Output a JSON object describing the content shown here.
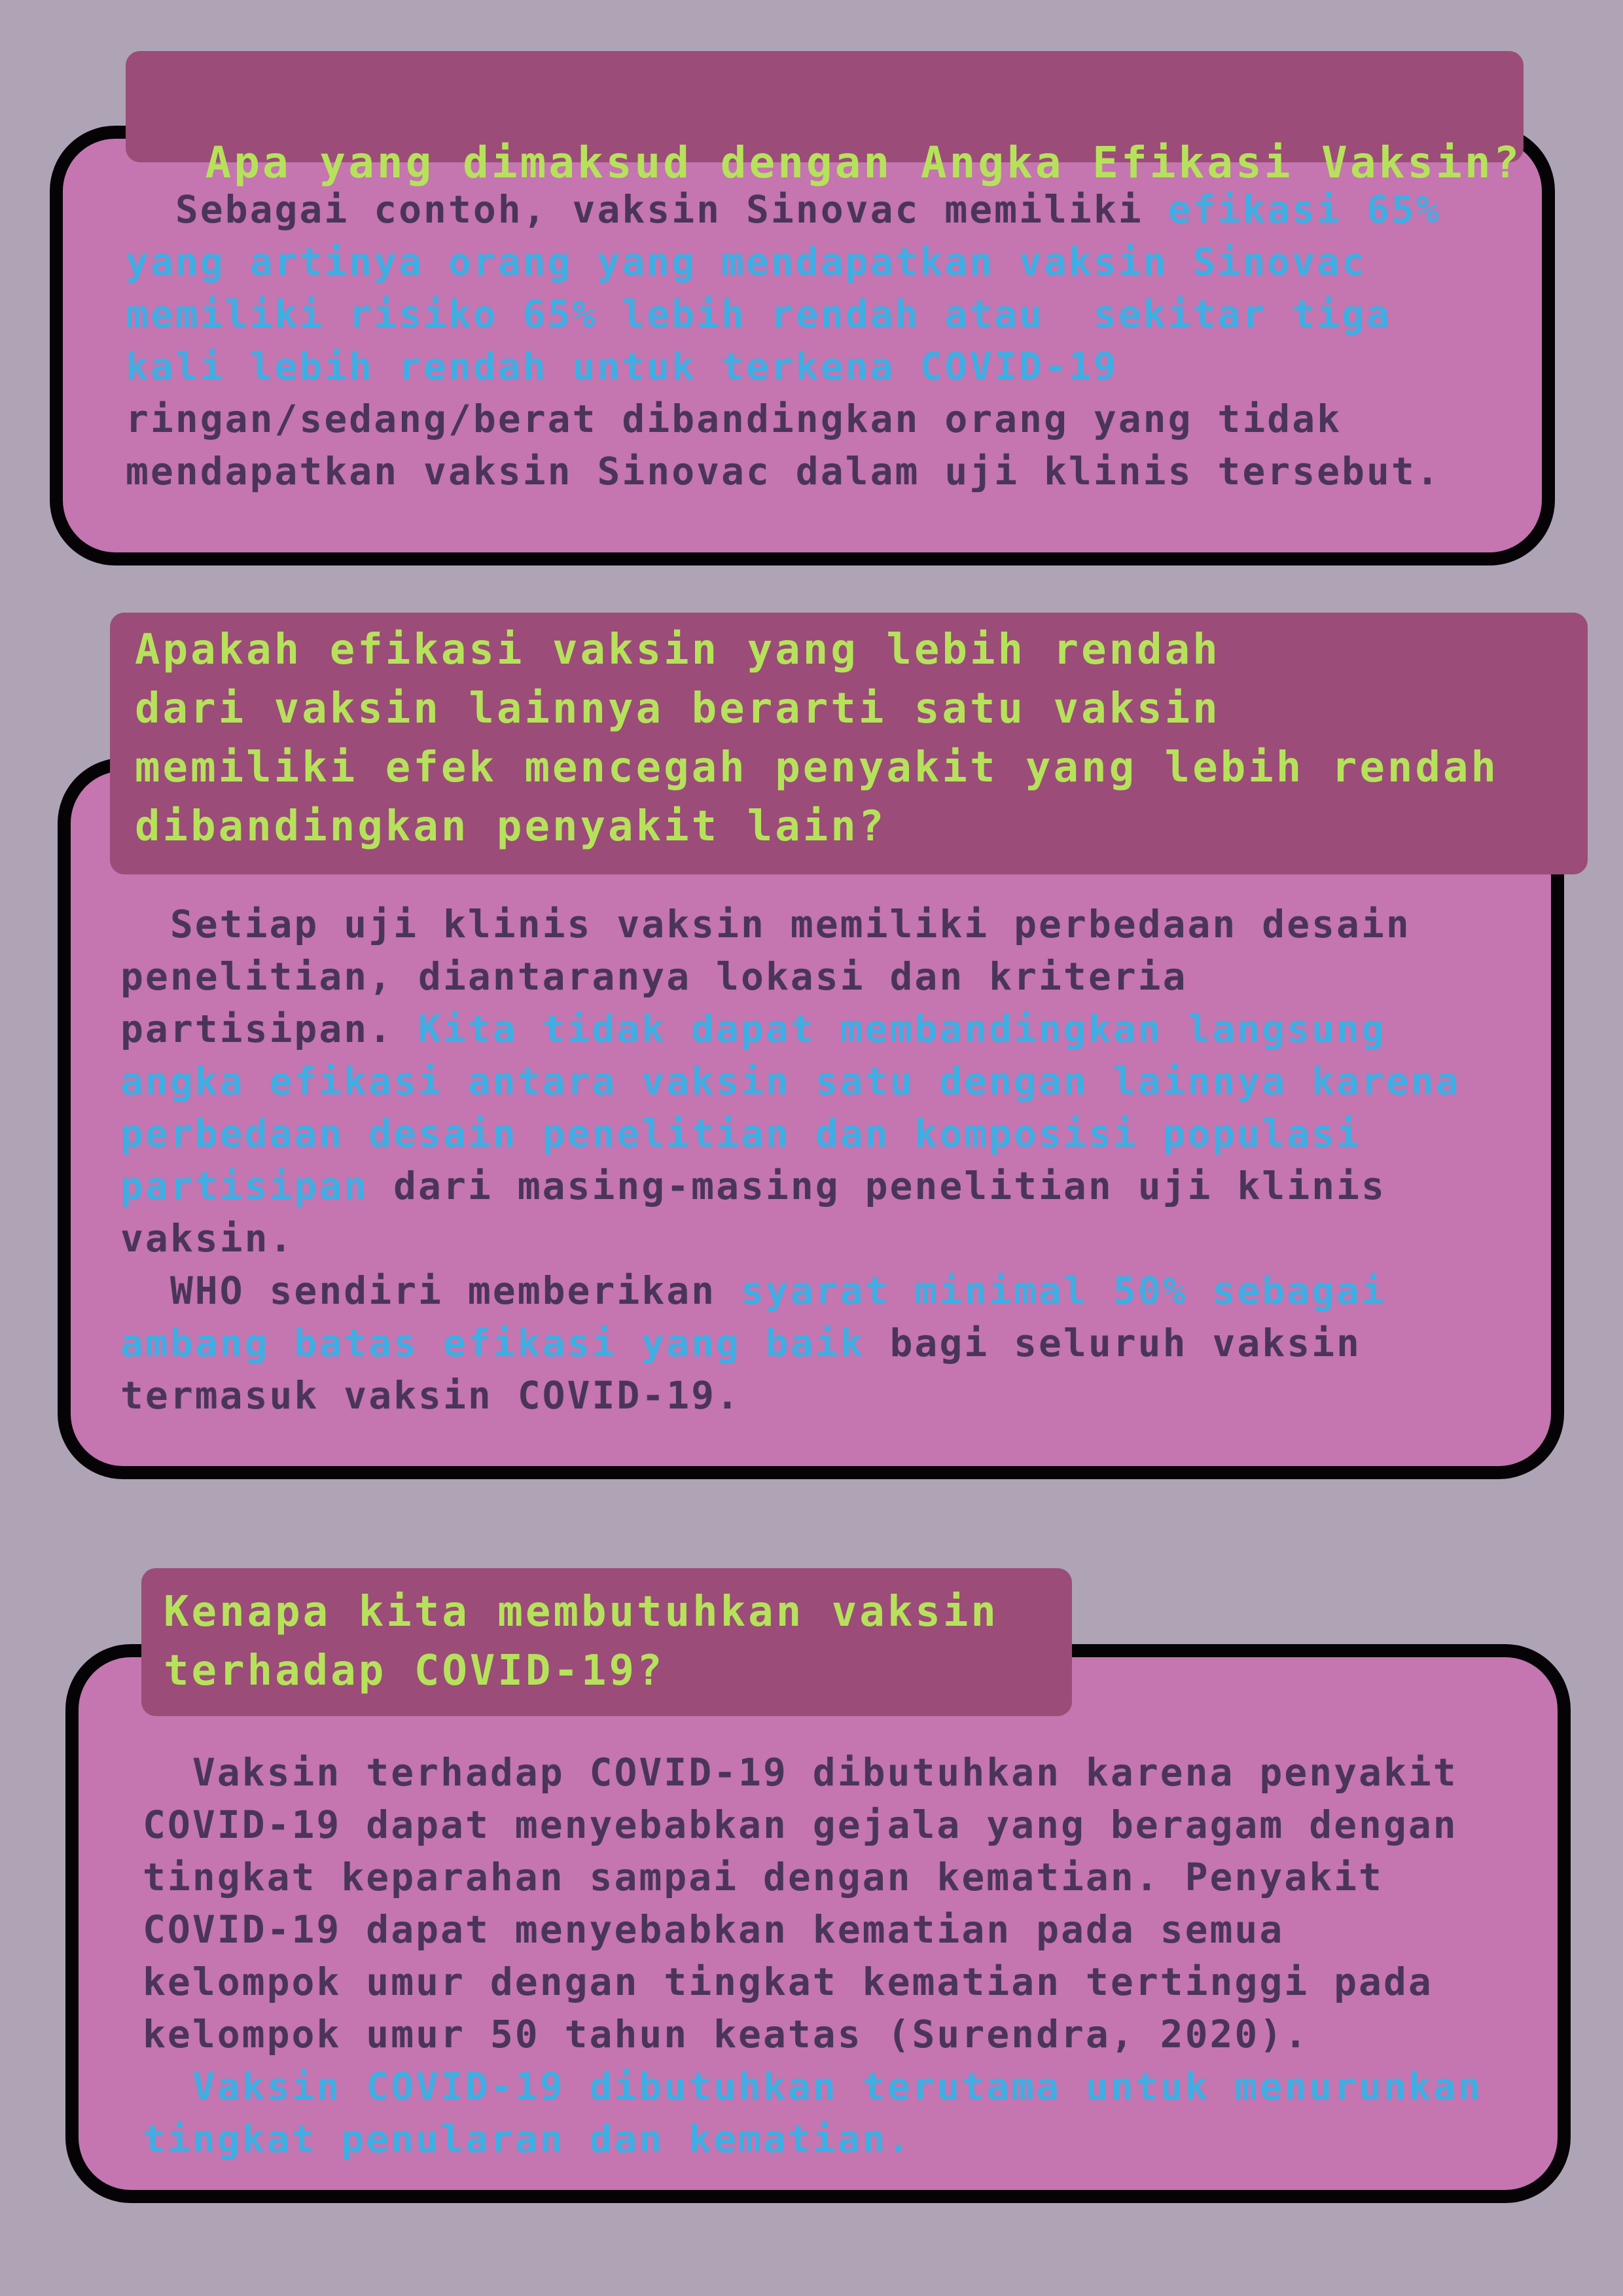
{
  "section1": {
    "title": "Apa yang dimaksud dengan Angka Efikasi Vaksin?",
    "body": [
      [
        {
          "t": "  Sebagai contoh, vaksin Sinovac memiliki ",
          "h": false
        },
        {
          "t": "efikasi 65%",
          "h": true
        }
      ],
      [
        {
          "t": "yang artinya orang yang mendapatkan vaksin Sinovac",
          "h": true
        }
      ],
      [
        {
          "t": "memiliki risiko 65% lebih rendah atau  sekitar tiga",
          "h": true
        }
      ],
      [
        {
          "t": "kali lebih rendah untuk terkena COVID-19",
          "h": true
        }
      ],
      [
        {
          "t": "ringan/sedang/berat dibandingkan orang yang tidak",
          "h": false
        }
      ],
      [
        {
          "t": "mendapatkan vaksin Sinovac dalam uji klinis tersebut.",
          "h": false
        }
      ]
    ]
  },
  "section2": {
    "title_lines": [
      "Apakah efikasi vaksin yang lebih rendah",
      "dari vaksin lainnya berarti satu vaksin",
      "memiliki efek mencegah penyakit yang lebih rendah",
      "dibandingkan penyakit lain?"
    ],
    "body": [
      [
        {
          "t": "  Setiap uji klinis vaksin memiliki perbedaan desain",
          "h": false
        }
      ],
      [
        {
          "t": "penelitian, diantaranya lokasi dan kriteria",
          "h": false
        }
      ],
      [
        {
          "t": "partisipan. ",
          "h": false
        },
        {
          "t": "Kita tidak dapat membandingkan langsung",
          "h": true
        }
      ],
      [
        {
          "t": "angka efikasi antara vaksin satu dengan lainnya karena",
          "h": true
        }
      ],
      [
        {
          "t": "perbedaan desain penelitian dan komposisi populasi",
          "h": true
        }
      ],
      [
        {
          "t": "partisipan",
          "h": true
        },
        {
          "t": " dari masing-masing penelitian uji klinis",
          "h": false
        }
      ],
      [
        {
          "t": "vaksin.",
          "h": false
        }
      ],
      [
        {
          "t": "  WHO sendiri memberikan ",
          "h": false
        },
        {
          "t": "syarat minimal 50% sebagai",
          "h": true
        }
      ],
      [
        {
          "t": "ambang batas efikasi yang baik",
          "h": true
        },
        {
          "t": " bagi seluruh vaksin",
          "h": false
        }
      ],
      [
        {
          "t": "termasuk vaksin COVID-19.",
          "h": false
        }
      ]
    ]
  },
  "section3": {
    "title_lines": [
      "Kenapa kita membutuhkan vaksin",
      "terhadap COVID-19?"
    ],
    "body": [
      [
        {
          "t": "  Vaksin terhadap COVID-19 dibutuhkan karena penyakit",
          "h": false
        }
      ],
      [
        {
          "t": "COVID-19 dapat menyebabkan gejala yang beragam dengan",
          "h": false
        }
      ],
      [
        {
          "t": "tingkat keparahan sampai dengan kematian. Penyakit",
          "h": false
        }
      ],
      [
        {
          "t": "COVID-19 dapat menyebabkan kematian pada semua",
          "h": false
        }
      ],
      [
        {
          "t": "kelompok umur dengan tingkat kematian tertinggi pada",
          "h": false
        }
      ],
      [
        {
          "t": "kelompok umur 50 tahun keatas (Surendra, 2020).",
          "h": false
        }
      ],
      [
        {
          "t": "  Vaksin COVID-19 dibutuhkan terutama untuk menurunkan",
          "h": true
        }
      ],
      [
        {
          "t": "tingkat penularan dan kematian.",
          "h": true
        }
      ]
    ]
  },
  "colors": {
    "background": "#aea4b6",
    "card": "#c575b0",
    "title_tab": "#9b4c78",
    "title_text": "#b6e25b",
    "body_text": "#4a3559",
    "highlight": "#3eaee3",
    "border": "#050305"
  }
}
